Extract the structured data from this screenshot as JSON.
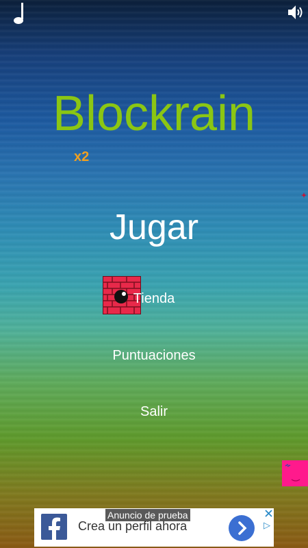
{
  "game": {
    "title": "Blockrain",
    "multiplier": "x2"
  },
  "menu": {
    "play": "Jugar",
    "shop": "Tienda",
    "scores": "Puntuaciones",
    "exit": "Salir"
  },
  "ad": {
    "label": "Anuncio de prueba",
    "text": "Crea un perfil ahora",
    "badge": "▷"
  },
  "colors": {
    "title": "#8bc613",
    "multiplier": "#f0a020",
    "brick": "#e8294a",
    "pink_block": "#ff1a8c",
    "facebook": "#3b5998"
  }
}
